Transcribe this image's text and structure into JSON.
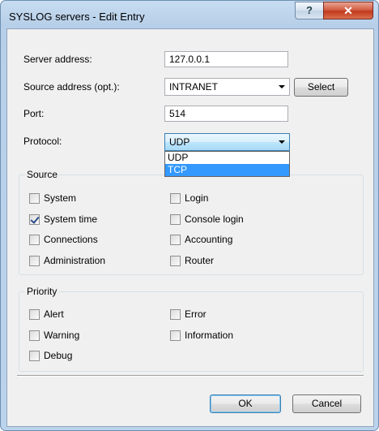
{
  "window": {
    "title": "SYSLOG servers - Edit Entry",
    "help_glyph": "?",
    "close_glyph": "✕"
  },
  "form": {
    "server_address": {
      "label": "Server address:",
      "value": "127.0.0.1"
    },
    "source_address": {
      "label": "Source address (opt.):",
      "value": "INTRANET",
      "select_button": "Select"
    },
    "port": {
      "label": "Port:",
      "value": "514"
    },
    "protocol": {
      "label": "Protocol:",
      "value": "UDP",
      "options": [
        "UDP",
        "TCP"
      ],
      "highlighted": "TCP"
    }
  },
  "source_group": {
    "title": "Source",
    "items": [
      {
        "label": "System",
        "checked": false
      },
      {
        "label": "Login",
        "checked": false
      },
      {
        "label": "System time",
        "checked": true
      },
      {
        "label": "Console login",
        "checked": false
      },
      {
        "label": "Connections",
        "checked": false
      },
      {
        "label": "Accounting",
        "checked": false
      },
      {
        "label": "Administration",
        "checked": false
      },
      {
        "label": "Router",
        "checked": false
      }
    ]
  },
  "priority_group": {
    "title": "Priority",
    "items": [
      {
        "label": "Alert",
        "checked": false
      },
      {
        "label": "Error",
        "checked": false
      },
      {
        "label": "Warning",
        "checked": false
      },
      {
        "label": "Information",
        "checked": false
      },
      {
        "label": "Debug",
        "checked": false
      }
    ]
  },
  "buttons": {
    "ok": "OK",
    "cancel": "Cancel"
  }
}
